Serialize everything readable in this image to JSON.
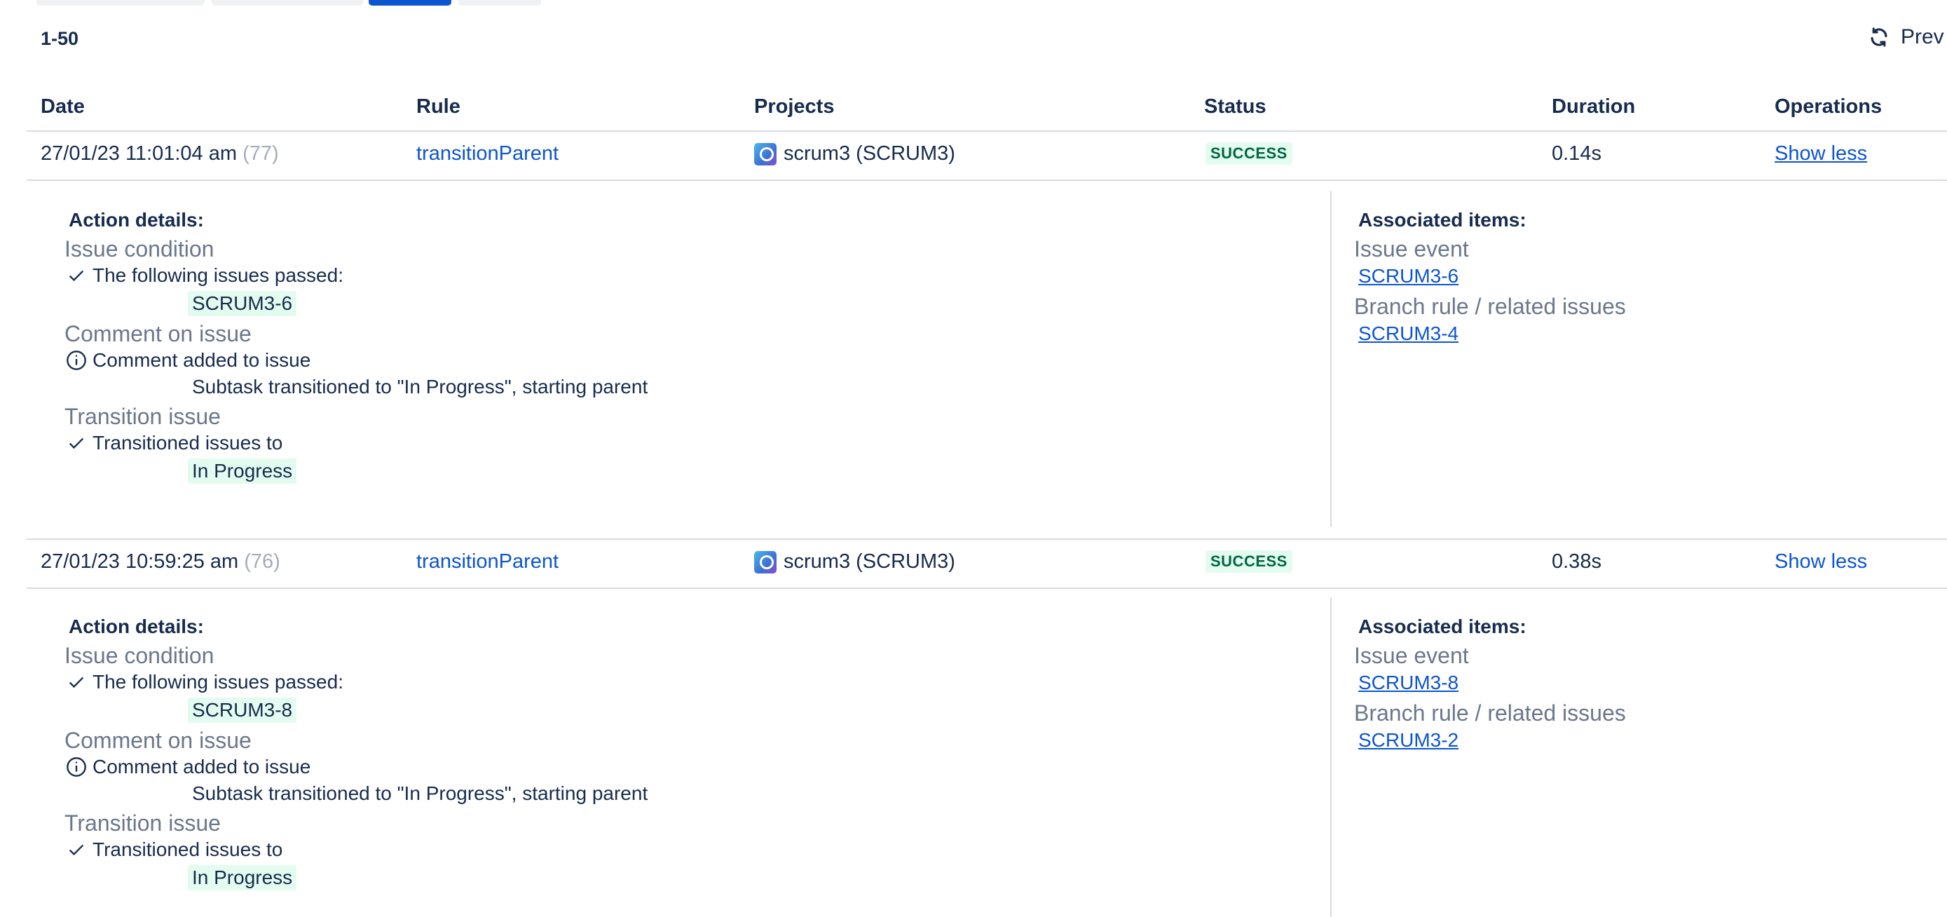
{
  "pagination": {
    "range": "1-50",
    "prev_label": "Prev"
  },
  "table": {
    "headers": [
      "Date",
      "Rule",
      "Projects",
      "Status",
      "Duration",
      "Operations"
    ]
  },
  "rows": [
    {
      "date": "27/01/23 11:01:04 am",
      "run": "(77)",
      "rule": "transitionParent",
      "project": "scrum3 (SCRUM3)",
      "status": "SUCCESS",
      "duration": "0.14s",
      "operation": "Show less",
      "details": {
        "action_heading": "Action details:",
        "cond_title": "Issue condition",
        "cond_line": "The following issues passed:",
        "cond_chip": "SCRUM3-6",
        "comment_title": "Comment on issue",
        "comment_line": "Comment added to issue",
        "comment_text": "Subtask transitioned to \"In Progress\", starting parent",
        "trans_title": "Transition issue",
        "trans_line": "Transitioned issues to",
        "trans_chip": "In Progress",
        "assoc_heading": "Associated items:",
        "event_title": "Issue event",
        "event_link": "SCRUM3-6",
        "branch_title": "Branch rule / related issues",
        "branch_link": "SCRUM3-4"
      }
    },
    {
      "date": "27/01/23 10:59:25 am",
      "run": "(76)",
      "rule": "transitionParent",
      "project": "scrum3 (SCRUM3)",
      "status": "SUCCESS",
      "duration": "0.38s",
      "operation": "Show less",
      "details": {
        "action_heading": "Action details:",
        "cond_title": "Issue condition",
        "cond_line": "The following issues passed:",
        "cond_chip": "SCRUM3-8",
        "comment_title": "Comment on issue",
        "comment_line": "Comment added to issue",
        "comment_text": "Subtask transitioned to \"In Progress\", starting parent",
        "trans_title": "Transition issue",
        "trans_line": "Transitioned issues to",
        "trans_chip": "In Progress",
        "assoc_heading": "Associated items:",
        "event_title": "Issue event",
        "event_link": "SCRUM3-8",
        "branch_title": "Branch rule / related issues",
        "branch_link": "SCRUM3-2"
      }
    }
  ],
  "icons": {
    "refresh": "refresh-icon",
    "check": "check-icon",
    "info": "info-icon",
    "project": "project-avatar-icon"
  },
  "colors": {
    "link": "#0c55d1",
    "success_bg": "#e3fcef",
    "success_text": "#006644",
    "muted": "#6b778c",
    "divider": "#d8dbe1"
  }
}
